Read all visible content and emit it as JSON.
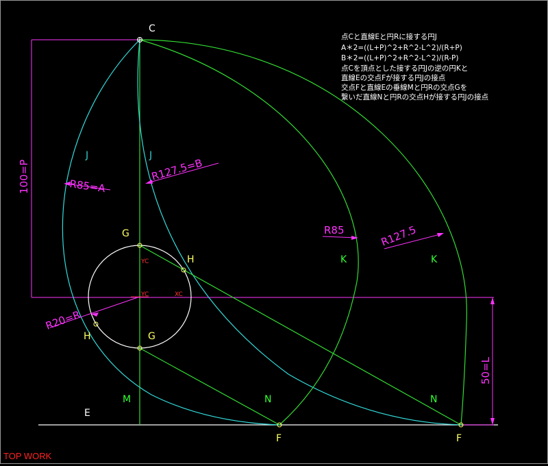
{
  "title_mark": "TOP WORK",
  "notes": [
    "点Cと直線Eと円Rに接する円J",
    "A＊2=((L+P)^2+R^2-L^2)/(R+P)",
    "B＊2=((L+P)^2+R^2-L^2)/(R-P)",
    "点Cを頂点とした接する円Jの逆の円Kと",
    "直線Eの交点Fが接する円Jの接点",
    "交点Fと直線Eの垂線Mと円Rの交点Gを",
    "繋いだ直線Nと円Rの交点Hが接する円Jの接点"
  ],
  "points": {
    "C": "C",
    "J1": "J",
    "J2": "J",
    "G1": "G",
    "G2": "G",
    "H1": "H",
    "H2": "H",
    "K1": "K",
    "K2": "K",
    "E": "E",
    "M": "M",
    "N1": "N",
    "N2": "N",
    "F1": "F",
    "F2": "F"
  },
  "dimensions": {
    "r85a": "R85=A",
    "r1275b": "R127.5=B",
    "r85": "R85",
    "r1275": "R127.5",
    "r20": "R20=R",
    "p": "100=P",
    "l": "50=L"
  },
  "markers": {
    "yc1": "YC",
    "yc2": "YC",
    "xc": "XC"
  },
  "colors": {
    "background": "#000000",
    "cyan": "#33dddd",
    "green": "#33dd33",
    "magenta": "#ff33ff",
    "white": "#ffffff",
    "yellow": "#ffff66"
  }
}
